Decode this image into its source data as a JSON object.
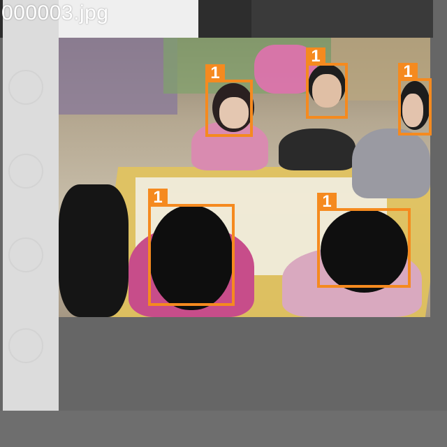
{
  "viewer": {
    "filename": "000003.jpg"
  },
  "detections": [
    {
      "label": "1"
    },
    {
      "label": "1"
    },
    {
      "label": "1"
    },
    {
      "label": "1"
    },
    {
      "label": "1"
    }
  ],
  "colors": {
    "box": "#f58a1f",
    "background": "#666666",
    "side_panel": "#dcdcdc"
  }
}
